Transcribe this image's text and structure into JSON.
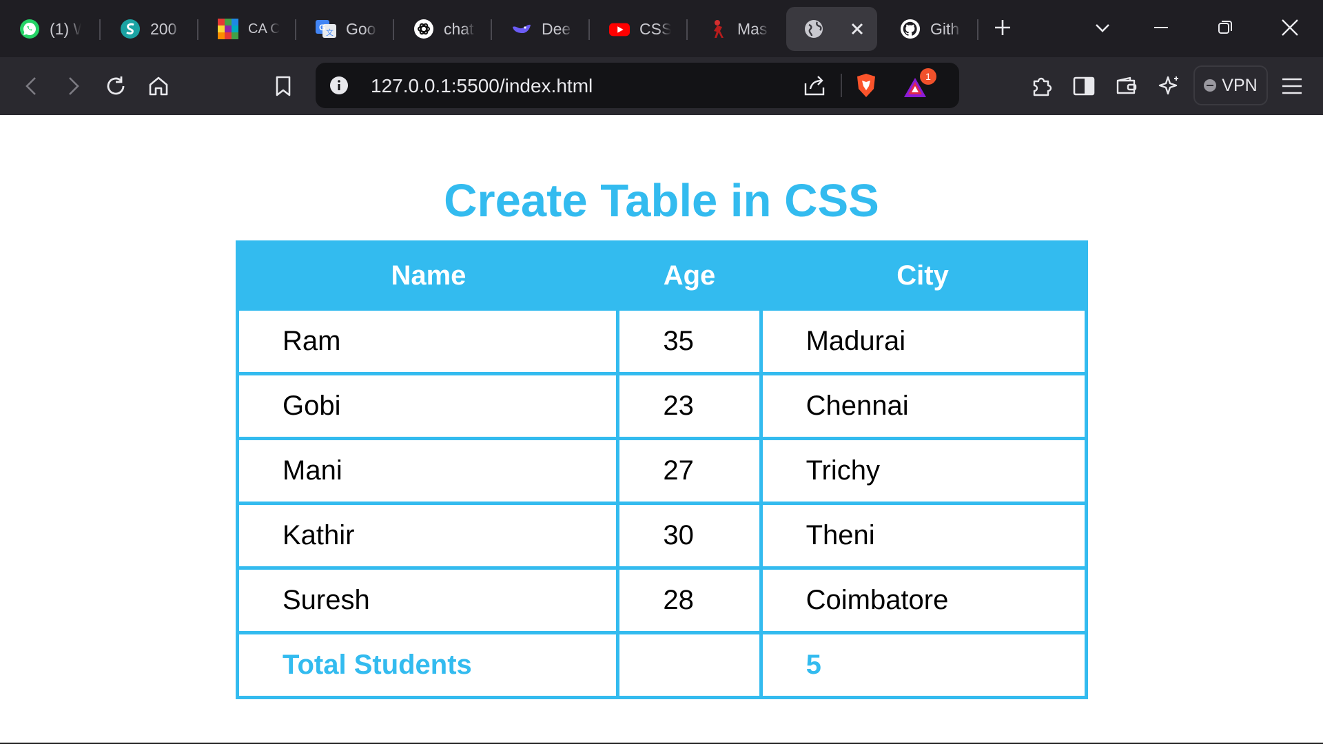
{
  "tabs": [
    {
      "title": "(1) W",
      "icon": "whatsapp-icon"
    },
    {
      "title": "200",
      "icon": "swirl-icon"
    },
    {
      "title": "CA C",
      "icon": "colorgrid-icon"
    },
    {
      "title": "Goo",
      "icon": "google-translate-icon"
    },
    {
      "title": "chat",
      "icon": "chatgpt-icon"
    },
    {
      "title": "Dee",
      "icon": "deepseek-icon"
    },
    {
      "title": "CSS",
      "icon": "youtube-icon"
    },
    {
      "title": "Mas",
      "icon": "figure-icon"
    },
    {
      "title": "",
      "icon": "globe-icon",
      "active": true
    },
    {
      "title": "Gith",
      "icon": "github-icon"
    }
  ],
  "toolbar": {
    "url": "127.0.0.1:5500/index.html",
    "vpn_label": "VPN",
    "notification_count": "1"
  },
  "page": {
    "title": "Create Table in CSS",
    "headers": [
      "Name",
      "Age",
      "City"
    ],
    "rows": [
      [
        "Ram",
        "35",
        "Madurai"
      ],
      [
        "Gobi",
        "23",
        "Chennai"
      ],
      [
        "Mani",
        "27",
        "Trichy"
      ],
      [
        "Kathir",
        "30",
        "Theni"
      ],
      [
        "Suresh",
        "28",
        "Coimbatore"
      ]
    ],
    "total": {
      "label": "Total Students",
      "age": "",
      "value": "5"
    }
  },
  "colors": {
    "accent": "#33bbef",
    "tabstrip_bg": "#1f1e23",
    "toolbar_bg": "#2a292f",
    "omnibox_bg": "#131316"
  }
}
